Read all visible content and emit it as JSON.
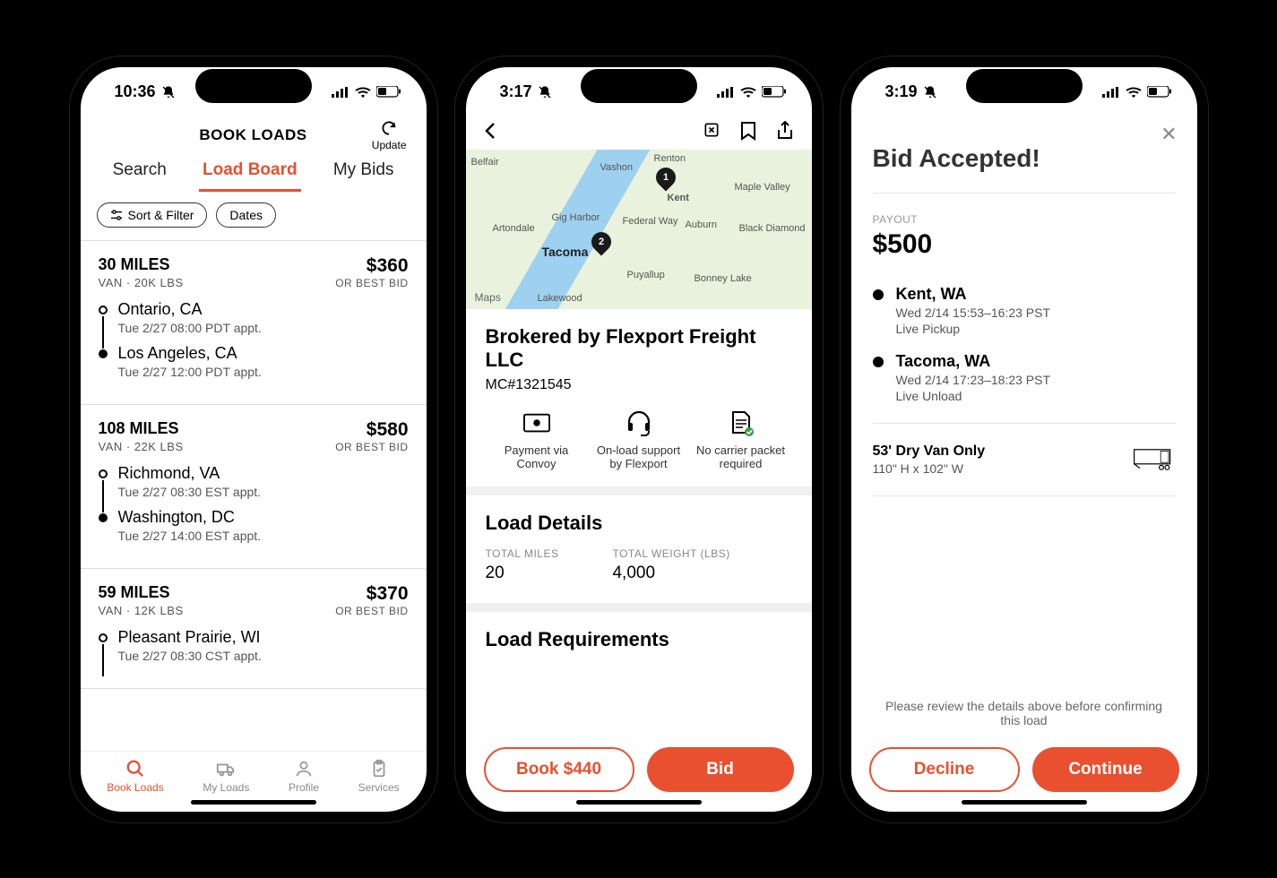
{
  "phone1": {
    "time": "10:36",
    "header": {
      "title": "BOOK LOADS",
      "update": "Update"
    },
    "tabs": [
      "Search",
      "Load Board",
      "My Bids"
    ],
    "chips": {
      "sort": "Sort & Filter",
      "dates": "Dates"
    },
    "loads": [
      {
        "miles": "30 MILES",
        "sub": "VAN · 20K LBS",
        "price": "$360",
        "bid": "OR BEST BID",
        "stops": [
          {
            "city": "Ontario, CA",
            "time": "Tue 2/27 08:00 PDT appt."
          },
          {
            "city": "Los Angeles, CA",
            "time": "Tue 2/27 12:00 PDT appt."
          }
        ]
      },
      {
        "miles": "108 MILES",
        "sub": "VAN · 22K LBS",
        "price": "$580",
        "bid": "OR BEST BID",
        "stops": [
          {
            "city": "Richmond, VA",
            "time": "Tue 2/27 08:30 EST appt."
          },
          {
            "city": "Washington, DC",
            "time": "Tue 2/27 14:00 EST appt."
          }
        ]
      },
      {
        "miles": "59 MILES",
        "sub": "VAN · 12K LBS",
        "price": "$370",
        "bid": "OR BEST BID",
        "stops": [
          {
            "city": "Pleasant Prairie, WI",
            "time": "Tue 2/27 08:30 CST appt."
          }
        ]
      }
    ],
    "nav": [
      "Book Loads",
      "My Loads",
      "Profile",
      "Services"
    ]
  },
  "phone2": {
    "time": "3:17",
    "map": {
      "badge": "Maps",
      "labels": [
        "Belfair",
        "Vashon",
        "Renton",
        "Kent",
        "Maple Valley",
        "Black Diamond",
        "Auburn",
        "Federal Way",
        "Gig Harbor",
        "Artondale",
        "Tacoma",
        "Puyallup",
        "Bonney Lake",
        "Lakewood"
      ],
      "pins": [
        "1",
        "2"
      ]
    },
    "broker": "Brokered by Flexport Freight LLC",
    "mc": "MC#1321545",
    "features": [
      "Payment via Convoy",
      "On-load support by Flexport",
      "No carrier packet required"
    ],
    "load_details_title": "Load Details",
    "miles_lbl": "TOTAL MILES",
    "miles_val": "20",
    "weight_lbl": "TOTAL WEIGHT (LBS)",
    "weight_val": "4,000",
    "load_req_title": "Load Requirements",
    "book_btn": "Book $440",
    "bid_btn": "Bid"
  },
  "phone3": {
    "time": "3:19",
    "title": "Bid Accepted!",
    "payout_lbl": "PAYOUT",
    "payout_val": "$500",
    "stops": [
      {
        "city": "Kent, WA",
        "l1": "Wed 2/14 15:53–16:23 PST",
        "l2": "Live Pickup"
      },
      {
        "city": "Tacoma, WA",
        "l1": "Wed 2/14 17:23–18:23 PST",
        "l2": "Live Unload"
      }
    ],
    "equip": {
      "t1": "53' Dry Van Only",
      "t2": "110\" H x 102\" W"
    },
    "note": "Please review the details above before confirming this load",
    "decline": "Decline",
    "continue": "Continue"
  }
}
